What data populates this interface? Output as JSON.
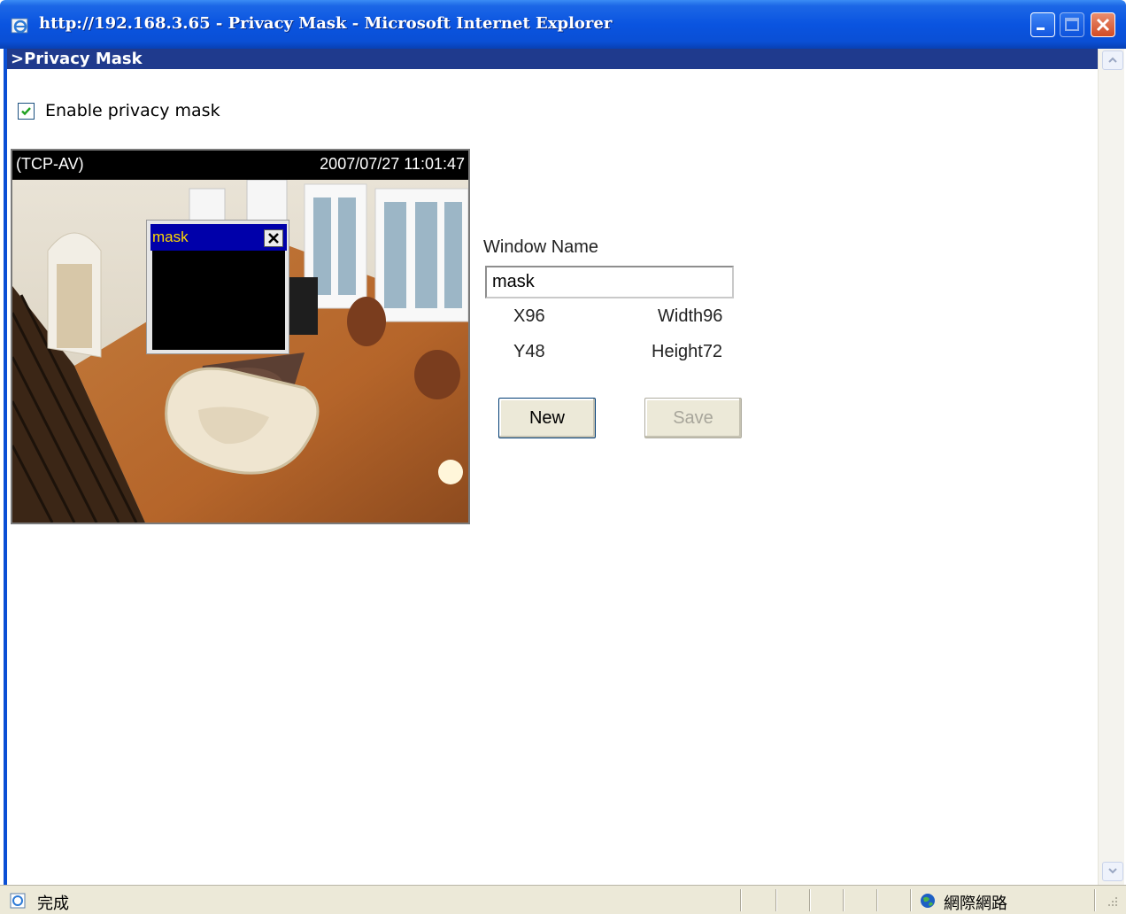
{
  "window": {
    "title": "http://192.168.3.65 - Privacy Mask - Microsoft Internet Explorer",
    "controls": [
      "minimize-icon",
      "maximize-icon",
      "close-icon"
    ]
  },
  "page": {
    "header": ">Privacy Mask",
    "enable_label": "Enable privacy mask",
    "enable_checked": true
  },
  "video": {
    "protocol": "(TCP-AV)",
    "timestamp": "2007/07/27 11:01:47",
    "mask_window_title": "mask"
  },
  "form": {
    "window_name_label": "Window Name",
    "window_name_value": "mask",
    "x": "X96",
    "y": "Y48",
    "width": "Width96",
    "height": "Height72",
    "new_label": "New",
    "save_label": "Save"
  },
  "status": {
    "text": "完成",
    "zone": "網際網路"
  },
  "colors": {
    "title_blue": "#0a54e0",
    "header_blue": "#1f3a8d",
    "mask_title_bar": "#0000aa",
    "mask_title_text": "#ffd800"
  }
}
